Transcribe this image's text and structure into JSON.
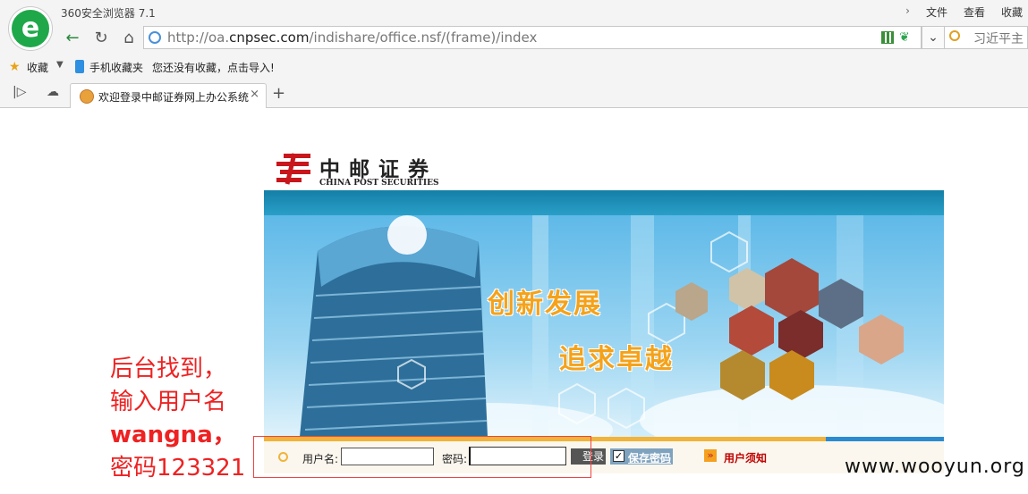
{
  "browser": {
    "title": "360安全浏览器 7.1",
    "menu": [
      "文件",
      "查看",
      "收藏"
    ],
    "url_prefix": "http://oa.",
    "url_domain": "cnpsec.com",
    "url_path": "/indishare/office.nsf/(frame)/index",
    "search_text": "习近平主"
  },
  "bookmarks": {
    "favorites": "收藏",
    "mobile": "手机收藏夹",
    "hint": "您还没有收藏，点击导入!"
  },
  "tab": {
    "title": "欢迎登录中邮证券网上办公系统",
    "close": "×",
    "new": "+"
  },
  "page": {
    "logo_cn": "中邮证券",
    "logo_en": "CHINA POST SECURITIES",
    "slogan1": "创新发展",
    "slogan2": "追求卓越",
    "login": {
      "user_label": "用户名:",
      "user_value": "",
      "pass_label": "密码:",
      "pass_value": "",
      "login_button": "登录",
      "save_password": "保存密码",
      "notice": "用户须知"
    }
  },
  "annotation": {
    "line1": "后台找到，",
    "line2": "输入用户名",
    "line3": "wangna，",
    "line4": "密码123321"
  },
  "watermark": "www.wooyun.org",
  "colors": {
    "accent_orange": "#f1b33a",
    "annotation_red": "#ee2222",
    "banner_blue": "#147fa7"
  }
}
